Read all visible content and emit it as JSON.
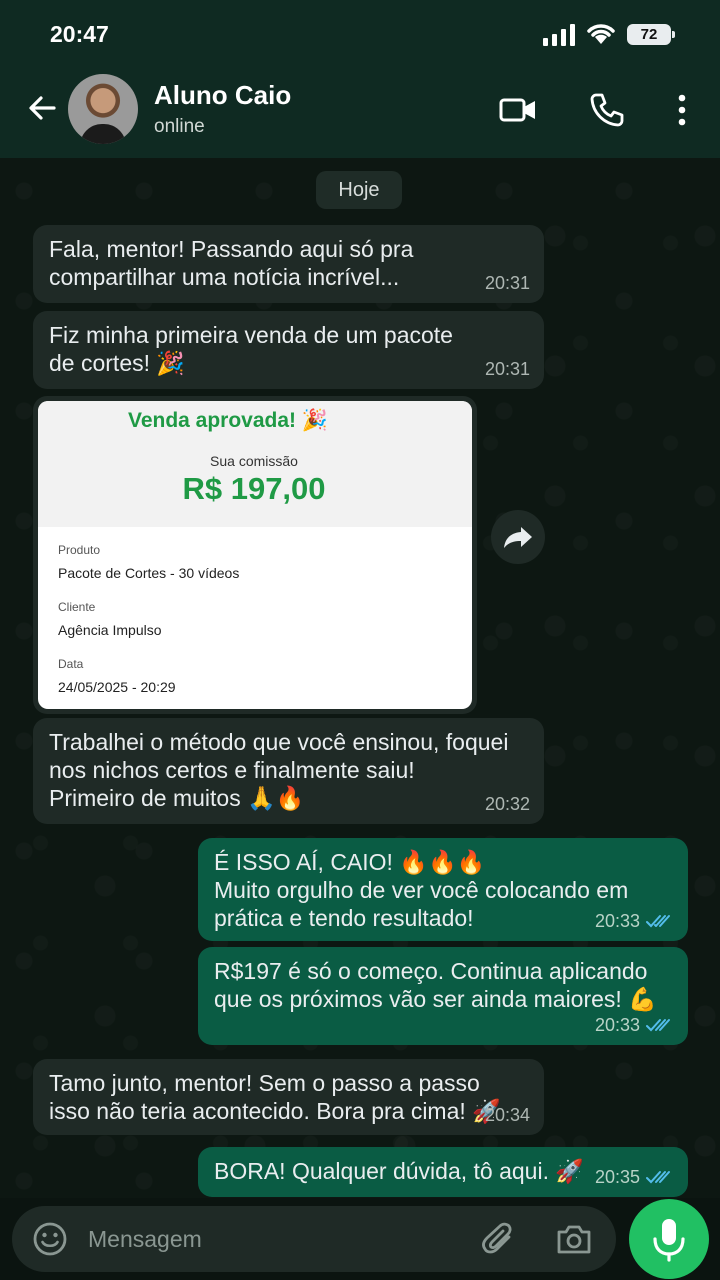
{
  "status_bar": {
    "time": "20:47",
    "battery": "72"
  },
  "header": {
    "contact_name": "Aluno Caio",
    "contact_status": "online"
  },
  "date_chip": "Hoje",
  "messages": [
    {
      "dir": "in",
      "text": "Fala, mentor! Passando aqui só pra\ncompartilhar uma notícia incrível...",
      "time": "20:31"
    },
    {
      "dir": "in",
      "text": "Fiz minha primeira venda de um pacote\nde cortes! 🎉",
      "time": "20:31"
    },
    {
      "dir": "in",
      "text": "Trabalhei o método que você ensinou, foquei\nnos nichos certos e finalmente saiu!\nPrimeiro de muitos 🙏🔥",
      "time": "20:32"
    },
    {
      "dir": "out",
      "text": "É ISSO AÍ, CAIO! 🔥🔥🔥\nMuito orgulho de ver você colocando em\nprática e tendo resultado!",
      "time": "20:33"
    },
    {
      "dir": "out",
      "text": "R$197 é só o começo. Continua aplicando\nque os próximos vão ser ainda maiores! 💪",
      "time": "20:33"
    },
    {
      "dir": "in",
      "text": "Tamo junto, mentor! Sem o passo a passo\nisso não teria acontecido. Bora pra cima! 🚀",
      "time": "20:34"
    },
    {
      "dir": "out",
      "text": "BORA! Qualquer dúvida, tô aqui. 🚀",
      "time": "20:35"
    }
  ],
  "receipt": {
    "title": "Venda aprovada! 🎉",
    "commission_label": "Sua comissão",
    "commission_value": "R$ 197,00",
    "product_label": "Produto",
    "product_value": "Pacote de Cortes - 30 vídeos",
    "client_label": "Cliente",
    "client_value": "Agência Impulso",
    "date_label": "Data",
    "date_value": "24/05/2025 - 20:29"
  },
  "composer": {
    "placeholder": "Mensagem"
  },
  "colors": {
    "header_bg": "#0f2a22",
    "incoming_bubble": "#1f2a26",
    "outgoing_bubble": "#0a5c44",
    "accent_green": "#21c063",
    "read_ticks": "#53bdeb"
  }
}
